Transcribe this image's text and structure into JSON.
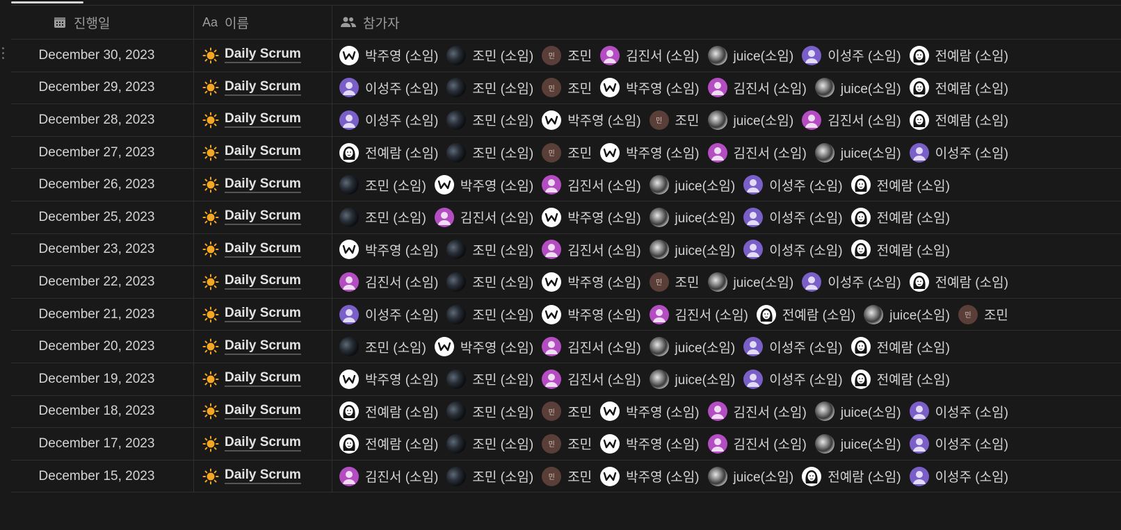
{
  "columns": {
    "date": "진행일",
    "name": "이름",
    "participants": "참가자",
    "name_icon_text": "Aa"
  },
  "avatar_min_text": "민",
  "colors": {
    "background": "#191919",
    "text": "#d4d4d4",
    "header_text": "#9b9b9b",
    "border": "#2f2f2f",
    "sun": "#f5a623"
  },
  "icons": {
    "date_column": "calendar-icon",
    "participants_column": "people-icon",
    "title": "sun-icon"
  },
  "rows": [
    {
      "date": "December 30, 2023",
      "title": "Daily Scrum",
      "participants": [
        {
          "name": "박주영 (소임)",
          "avatar": "w"
        },
        {
          "name": "조민 (소임)",
          "avatar": "dark"
        },
        {
          "name": "조민",
          "avatar": "min"
        },
        {
          "name": "김진서 (소임)",
          "avatar": "pink"
        },
        {
          "name": "juice(소임)",
          "avatar": "juice"
        },
        {
          "name": "이성주 (소임)",
          "avatar": "purple"
        },
        {
          "name": "전예람 (소임)",
          "avatar": "jeon"
        }
      ]
    },
    {
      "date": "December 29, 2023",
      "title": "Daily Scrum",
      "participants": [
        {
          "name": "이성주 (소임)",
          "avatar": "purple"
        },
        {
          "name": "조민 (소임)",
          "avatar": "dark"
        },
        {
          "name": "조민",
          "avatar": "min"
        },
        {
          "name": "박주영 (소임)",
          "avatar": "w"
        },
        {
          "name": "김진서 (소임)",
          "avatar": "pink"
        },
        {
          "name": "juice(소임)",
          "avatar": "juice"
        },
        {
          "name": "전예람 (소임)",
          "avatar": "jeon"
        }
      ]
    },
    {
      "date": "December 28, 2023",
      "title": "Daily Scrum",
      "participants": [
        {
          "name": "이성주 (소임)",
          "avatar": "purple"
        },
        {
          "name": "조민 (소임)",
          "avatar": "dark"
        },
        {
          "name": "박주영 (소임)",
          "avatar": "w"
        },
        {
          "name": "조민",
          "avatar": "min"
        },
        {
          "name": "juice(소임)",
          "avatar": "juice"
        },
        {
          "name": "김진서 (소임)",
          "avatar": "pink"
        },
        {
          "name": "전예람 (소임)",
          "avatar": "jeon"
        }
      ]
    },
    {
      "date": "December 27, 2023",
      "title": "Daily Scrum",
      "participants": [
        {
          "name": "전예람 (소임)",
          "avatar": "jeon"
        },
        {
          "name": "조민 (소임)",
          "avatar": "dark"
        },
        {
          "name": "조민",
          "avatar": "min"
        },
        {
          "name": "박주영 (소임)",
          "avatar": "w"
        },
        {
          "name": "김진서 (소임)",
          "avatar": "pink"
        },
        {
          "name": "juice(소임)",
          "avatar": "juice"
        },
        {
          "name": "이성주 (소임)",
          "avatar": "purple"
        }
      ]
    },
    {
      "date": "December 26, 2023",
      "title": "Daily Scrum",
      "participants": [
        {
          "name": "조민 (소임)",
          "avatar": "dark"
        },
        {
          "name": "박주영 (소임)",
          "avatar": "w"
        },
        {
          "name": "김진서 (소임)",
          "avatar": "pink"
        },
        {
          "name": "juice(소임)",
          "avatar": "juice"
        },
        {
          "name": "이성주 (소임)",
          "avatar": "purple"
        },
        {
          "name": "전예람 (소임)",
          "avatar": "jeon"
        }
      ]
    },
    {
      "date": "December 25, 2023",
      "title": "Daily Scrum",
      "participants": [
        {
          "name": "조민 (소임)",
          "avatar": "dark"
        },
        {
          "name": "김진서 (소임)",
          "avatar": "pink"
        },
        {
          "name": "박주영 (소임)",
          "avatar": "w"
        },
        {
          "name": "juice(소임)",
          "avatar": "juice"
        },
        {
          "name": "이성주 (소임)",
          "avatar": "purple"
        },
        {
          "name": "전예람 (소임)",
          "avatar": "jeon"
        }
      ]
    },
    {
      "date": "December 23, 2023",
      "title": "Daily Scrum",
      "participants": [
        {
          "name": "박주영 (소임)",
          "avatar": "w"
        },
        {
          "name": "조민 (소임)",
          "avatar": "dark"
        },
        {
          "name": "김진서 (소임)",
          "avatar": "pink"
        },
        {
          "name": "juice(소임)",
          "avatar": "juice"
        },
        {
          "name": "이성주 (소임)",
          "avatar": "purple"
        },
        {
          "name": "전예람 (소임)",
          "avatar": "jeon"
        }
      ]
    },
    {
      "date": "December 22, 2023",
      "title": "Daily Scrum",
      "participants": [
        {
          "name": "김진서 (소임)",
          "avatar": "pink"
        },
        {
          "name": "조민 (소임)",
          "avatar": "dark"
        },
        {
          "name": "박주영 (소임)",
          "avatar": "w"
        },
        {
          "name": "조민",
          "avatar": "min"
        },
        {
          "name": "juice(소임)",
          "avatar": "juice"
        },
        {
          "name": "이성주 (소임)",
          "avatar": "purple"
        },
        {
          "name": "전예람 (소임)",
          "avatar": "jeon"
        }
      ]
    },
    {
      "date": "December 21, 2023",
      "title": "Daily Scrum",
      "participants": [
        {
          "name": "이성주 (소임)",
          "avatar": "purple"
        },
        {
          "name": "조민 (소임)",
          "avatar": "dark"
        },
        {
          "name": "박주영 (소임)",
          "avatar": "w"
        },
        {
          "name": "김진서 (소임)",
          "avatar": "pink"
        },
        {
          "name": "전예람 (소임)",
          "avatar": "jeon"
        },
        {
          "name": "juice(소임)",
          "avatar": "juice"
        },
        {
          "name": "조민",
          "avatar": "min"
        }
      ]
    },
    {
      "date": "December 20, 2023",
      "title": "Daily Scrum",
      "participants": [
        {
          "name": "조민 (소임)",
          "avatar": "dark"
        },
        {
          "name": "박주영 (소임)",
          "avatar": "w"
        },
        {
          "name": "김진서 (소임)",
          "avatar": "pink"
        },
        {
          "name": "juice(소임)",
          "avatar": "juice"
        },
        {
          "name": "이성주 (소임)",
          "avatar": "purple"
        },
        {
          "name": "전예람 (소임)",
          "avatar": "jeon"
        }
      ]
    },
    {
      "date": "December 19, 2023",
      "title": "Daily Scrum",
      "participants": [
        {
          "name": "박주영 (소임)",
          "avatar": "w"
        },
        {
          "name": "조민 (소임)",
          "avatar": "dark"
        },
        {
          "name": "김진서 (소임)",
          "avatar": "pink"
        },
        {
          "name": "juice(소임)",
          "avatar": "juice"
        },
        {
          "name": "이성주 (소임)",
          "avatar": "purple"
        },
        {
          "name": "전예람 (소임)",
          "avatar": "jeon"
        }
      ]
    },
    {
      "date": "December 18, 2023",
      "title": "Daily Scrum",
      "participants": [
        {
          "name": "전예람 (소임)",
          "avatar": "jeon"
        },
        {
          "name": "조민 (소임)",
          "avatar": "dark"
        },
        {
          "name": "조민",
          "avatar": "min"
        },
        {
          "name": "박주영 (소임)",
          "avatar": "w"
        },
        {
          "name": "김진서 (소임)",
          "avatar": "pink"
        },
        {
          "name": "juice(소임)",
          "avatar": "juice"
        },
        {
          "name": "이성주 (소임)",
          "avatar": "purple"
        }
      ]
    },
    {
      "date": "December 17, 2023",
      "title": "Daily Scrum",
      "participants": [
        {
          "name": "전예람 (소임)",
          "avatar": "jeon"
        },
        {
          "name": "조민 (소임)",
          "avatar": "dark"
        },
        {
          "name": "조민",
          "avatar": "min"
        },
        {
          "name": "박주영 (소임)",
          "avatar": "w"
        },
        {
          "name": "김진서 (소임)",
          "avatar": "pink"
        },
        {
          "name": "juice(소임)",
          "avatar": "juice"
        },
        {
          "name": "이성주 (소임)",
          "avatar": "purple"
        }
      ]
    },
    {
      "date": "December 15, 2023",
      "title": "Daily Scrum",
      "participants": [
        {
          "name": "김진서 (소임)",
          "avatar": "pink"
        },
        {
          "name": "조민 (소임)",
          "avatar": "dark"
        },
        {
          "name": "조민",
          "avatar": "min"
        },
        {
          "name": "박주영 (소임)",
          "avatar": "w"
        },
        {
          "name": "juice(소임)",
          "avatar": "juice"
        },
        {
          "name": "전예람 (소임)",
          "avatar": "jeon"
        },
        {
          "name": "이성주 (소임)",
          "avatar": "purple"
        }
      ]
    }
  ]
}
